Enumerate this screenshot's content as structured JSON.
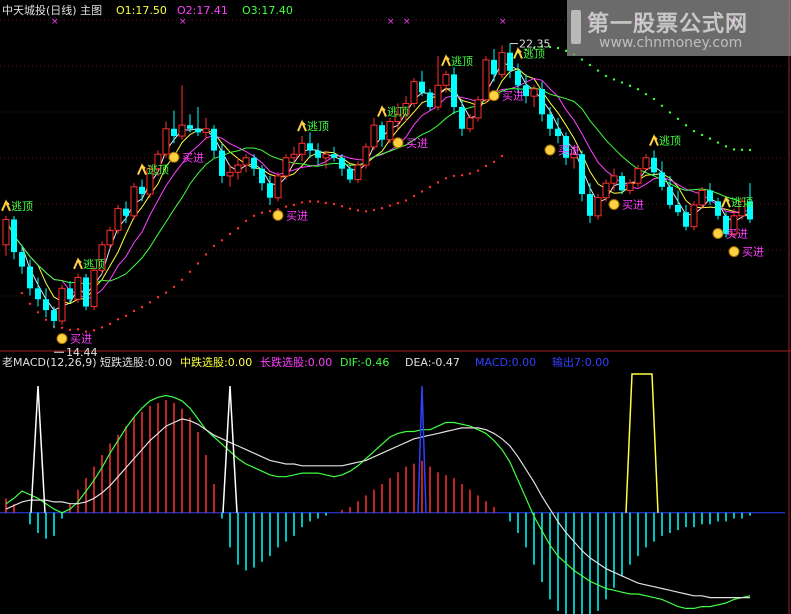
{
  "header": {
    "title": "中天城投(日线) 主图",
    "o1": "O1:17.50",
    "o2": "O2:17.41",
    "o3": "O3:17.40"
  },
  "indicator_header": {
    "name": "老MACD(12,26,9)",
    "short": "短跌选股:0.00",
    "mid": "中跌选股:0.00",
    "long": "长跌选股:0.00",
    "dif": "DIF:-0.46",
    "dea": "DEA:-0.47",
    "macd": "MACD:0.00",
    "output": "输出7:0.00"
  },
  "watermark": {
    "title": "第一股票公式网",
    "url": "www.chnmoney.com"
  },
  "colors": {
    "up": "#ff3030",
    "down": "#00ffff",
    "buy_text": "#ff40ff",
    "sell_text": "#40ff40",
    "dif": "#40ff40",
    "dea": "#e0e0e0",
    "ma_white": "#e8e8e8",
    "ma_yellow": "#ffff40",
    "ma_magenta": "#ff40ff",
    "ma_green": "#40ff40",
    "signal_blue": "#3040ff",
    "signal_yellow": "#ffff40"
  },
  "chart_data": {
    "type": "candlestick+macd",
    "annotations": {
      "high_label": "22.35",
      "low_label": "14.44",
      "buy_label": "买进",
      "sell_label": "逃顶"
    },
    "candles": [
      [
        16.8,
        17.6,
        16.5,
        17.5
      ],
      [
        17.5,
        17.6,
        16.4,
        16.6
      ],
      [
        16.6,
        16.8,
        16.0,
        16.2
      ],
      [
        16.2,
        16.4,
        15.4,
        15.6
      ],
      [
        15.6,
        15.9,
        15.1,
        15.3
      ],
      [
        15.3,
        15.6,
        14.8,
        15.0
      ],
      [
        15.0,
        15.1,
        14.5,
        14.7
      ],
      [
        14.7,
        15.7,
        14.6,
        15.6
      ],
      [
        15.6,
        15.8,
        15.2,
        15.3
      ],
      [
        15.3,
        16.0,
        15.2,
        15.9
      ],
      [
        15.9,
        16.0,
        15.0,
        15.1
      ],
      [
        15.1,
        16.2,
        15.0,
        16.1
      ],
      [
        16.1,
        16.9,
        16.0,
        16.8
      ],
      [
        16.8,
        17.3,
        16.7,
        17.2
      ],
      [
        17.2,
        17.9,
        17.1,
        17.8
      ],
      [
        17.8,
        18.0,
        17.4,
        17.6
      ],
      [
        17.6,
        18.5,
        17.5,
        18.4
      ],
      [
        18.4,
        18.6,
        18.0,
        18.2
      ],
      [
        18.2,
        19.0,
        18.1,
        18.9
      ],
      [
        18.9,
        19.4,
        18.7,
        19.3
      ],
      [
        19.3,
        20.2,
        19.2,
        20.0
      ],
      [
        20.0,
        20.5,
        19.6,
        19.8
      ],
      [
        19.8,
        21.2,
        19.7,
        20.1
      ],
      [
        20.1,
        20.4,
        19.9,
        20.0
      ],
      [
        20.0,
        20.6,
        19.8,
        19.9
      ],
      [
        19.9,
        20.3,
        19.7,
        20.0
      ],
      [
        20.0,
        20.1,
        19.2,
        19.4
      ],
      [
        19.4,
        19.6,
        18.5,
        18.7
      ],
      [
        18.7,
        19.0,
        18.4,
        18.8
      ],
      [
        18.8,
        19.2,
        18.6,
        19.0
      ],
      [
        19.0,
        19.3,
        18.8,
        19.2
      ],
      [
        19.2,
        19.3,
        18.7,
        18.9
      ],
      [
        18.9,
        19.0,
        18.3,
        18.5
      ],
      [
        18.5,
        18.7,
        17.9,
        18.1
      ],
      [
        18.1,
        18.8,
        18.0,
        18.7
      ],
      [
        18.7,
        19.3,
        18.6,
        19.2
      ],
      [
        19.2,
        19.5,
        19.0,
        19.3
      ],
      [
        19.3,
        19.8,
        19.1,
        19.6
      ],
      [
        19.6,
        19.9,
        19.2,
        19.4
      ],
      [
        19.4,
        19.6,
        19.0,
        19.2
      ],
      [
        19.2,
        19.4,
        18.9,
        19.3
      ],
      [
        19.3,
        19.5,
        19.1,
        19.2
      ],
      [
        19.2,
        19.3,
        18.7,
        18.9
      ],
      [
        18.9,
        19.0,
        18.5,
        18.6
      ],
      [
        18.6,
        19.1,
        18.5,
        19.0
      ],
      [
        19.0,
        19.6,
        18.9,
        19.5
      ],
      [
        19.5,
        20.3,
        19.4,
        20.1
      ],
      [
        20.1,
        20.2,
        19.5,
        19.7
      ],
      [
        19.7,
        20.3,
        19.6,
        20.2
      ],
      [
        20.2,
        20.7,
        20.0,
        20.4
      ],
      [
        20.4,
        20.9,
        20.2,
        20.7
      ],
      [
        20.7,
        21.4,
        20.6,
        21.3
      ],
      [
        21.3,
        21.6,
        20.9,
        21.0
      ],
      [
        21.0,
        21.1,
        20.5,
        20.6
      ],
      [
        20.6,
        22.0,
        20.5,
        21.2
      ],
      [
        21.2,
        21.6,
        21.0,
        21.5
      ],
      [
        21.5,
        21.7,
        20.4,
        20.6
      ],
      [
        20.6,
        20.8,
        19.8,
        20.0
      ],
      [
        20.0,
        20.4,
        19.9,
        20.3
      ],
      [
        20.3,
        20.9,
        20.2,
        20.8
      ],
      [
        20.8,
        22.0,
        20.7,
        21.9
      ],
      [
        21.9,
        22.2,
        21.3,
        21.5
      ],
      [
        21.5,
        22.3,
        21.4,
        22.1
      ],
      [
        22.1,
        22.35,
        21.4,
        21.6
      ],
      [
        21.6,
        21.8,
        21.0,
        21.2
      ],
      [
        21.2,
        21.5,
        20.7,
        20.9
      ],
      [
        20.9,
        21.2,
        20.6,
        21.1
      ],
      [
        21.1,
        21.3,
        20.2,
        20.4
      ],
      [
        20.4,
        20.6,
        19.8,
        20.0
      ],
      [
        20.0,
        20.3,
        19.6,
        19.8
      ],
      [
        19.8,
        19.9,
        19.0,
        19.2
      ],
      [
        19.2,
        19.5,
        18.9,
        19.3
      ],
      [
        19.3,
        19.4,
        18.0,
        18.2
      ],
      [
        18.2,
        18.5,
        17.4,
        17.6
      ],
      [
        17.6,
        18.2,
        17.5,
        18.1
      ],
      [
        18.1,
        18.6,
        18.0,
        18.5
      ],
      [
        18.5,
        18.9,
        18.3,
        18.7
      ],
      [
        18.7,
        18.8,
        18.2,
        18.3
      ],
      [
        18.3,
        18.6,
        18.2,
        18.5
      ],
      [
        18.5,
        19.0,
        18.4,
        18.9
      ],
      [
        18.9,
        19.3,
        18.8,
        19.2
      ],
      [
        19.2,
        19.4,
        18.7,
        18.8
      ],
      [
        18.8,
        19.1,
        18.3,
        18.4
      ],
      [
        18.4,
        18.7,
        17.8,
        17.9
      ],
      [
        17.9,
        18.3,
        17.6,
        17.7
      ],
      [
        17.7,
        17.9,
        17.2,
        17.3
      ],
      [
        17.3,
        18.0,
        17.2,
        17.9
      ],
      [
        17.9,
        18.4,
        17.8,
        18.3
      ],
      [
        18.3,
        18.5,
        17.9,
        18.0
      ],
      [
        18.0,
        18.1,
        17.5,
        17.6
      ],
      [
        17.6,
        17.7,
        17.0,
        17.1
      ],
      [
        17.1,
        17.8,
        17.0,
        17.6
      ],
      [
        17.6,
        18.1,
        17.5,
        18.0
      ],
      [
        18.0,
        18.5,
        17.4,
        17.5
      ]
    ],
    "buy_points": [
      7,
      21,
      34,
      49,
      61,
      68,
      76,
      89,
      91
    ],
    "sell_points": [
      0,
      9,
      17,
      37,
      47,
      55,
      64,
      81,
      90
    ],
    "high_point_index": 63,
    "low_point_index": 6,
    "macd_hist": [
      0.05,
      0.03,
      0.0,
      -0.04,
      -0.07,
      -0.09,
      -0.08,
      -0.02,
      0.03,
      0.08,
      0.12,
      0.16,
      0.2,
      0.24,
      0.27,
      0.3,
      0.33,
      0.35,
      0.37,
      0.38,
      0.39,
      0.38,
      0.36,
      0.33,
      0.28,
      0.2,
      0.1,
      -0.02,
      -0.12,
      -0.18,
      -0.2,
      -0.19,
      -0.17,
      -0.15,
      -0.12,
      -0.1,
      -0.08,
      -0.05,
      -0.03,
      -0.02,
      -0.01,
      0.0,
      0.01,
      0.02,
      0.04,
      0.06,
      0.08,
      0.1,
      0.12,
      0.14,
      0.16,
      0.17,
      0.18,
      0.16,
      0.14,
      0.13,
      0.12,
      0.1,
      0.08,
      0.06,
      0.04,
      0.02,
      0.0,
      -0.03,
      -0.07,
      -0.12,
      -0.18,
      -0.24,
      -0.3,
      -0.34,
      -0.36,
      -0.38,
      -0.4,
      -0.38,
      -0.34,
      -0.3,
      -0.26,
      -0.22,
      -0.18,
      -0.15,
      -0.12,
      -0.1,
      -0.08,
      -0.07,
      -0.06,
      -0.05,
      -0.05,
      -0.04,
      -0.04,
      -0.03,
      -0.03,
      -0.02,
      -0.02,
      -0.01
    ],
    "dif": [
      0.05,
      0.08,
      0.12,
      0.1,
      0.08,
      0.05,
      0.02,
      0.0,
      0.02,
      0.06,
      0.12,
      0.18,
      0.25,
      0.33,
      0.4,
      0.47,
      0.53,
      0.58,
      0.62,
      0.64,
      0.65,
      0.64,
      0.62,
      0.58,
      0.52,
      0.46,
      0.42,
      0.38,
      0.34,
      0.3,
      0.27,
      0.25,
      0.23,
      0.21,
      0.2,
      0.2,
      0.21,
      0.22,
      0.22,
      0.22,
      0.21,
      0.2,
      0.21,
      0.23,
      0.26,
      0.3,
      0.34,
      0.38,
      0.42,
      0.44,
      0.45,
      0.45,
      0.46,
      0.46,
      0.48,
      0.5,
      0.5,
      0.49,
      0.48,
      0.46,
      0.44,
      0.4,
      0.35,
      0.28,
      0.18,
      0.08,
      -0.02,
      -0.1,
      -0.18,
      -0.24,
      -0.28,
      -0.32,
      -0.35,
      -0.38,
      -0.4,
      -0.42,
      -0.43,
      -0.44,
      -0.45,
      -0.45,
      -0.46,
      -0.47,
      -0.48,
      -0.5,
      -0.52,
      -0.53,
      -0.53,
      -0.52,
      -0.52,
      -0.51,
      -0.5,
      -0.48,
      -0.47,
      -0.46
    ],
    "dea": [
      0.02,
      0.04,
      0.06,
      0.07,
      0.07,
      0.07,
      0.06,
      0.06,
      0.05,
      0.05,
      0.06,
      0.08,
      0.11,
      0.15,
      0.2,
      0.25,
      0.3,
      0.35,
      0.4,
      0.44,
      0.48,
      0.5,
      0.52,
      0.51,
      0.49,
      0.46,
      0.43,
      0.41,
      0.39,
      0.37,
      0.35,
      0.33,
      0.31,
      0.29,
      0.28,
      0.27,
      0.27,
      0.26,
      0.26,
      0.26,
      0.26,
      0.26,
      0.26,
      0.27,
      0.28,
      0.29,
      0.31,
      0.33,
      0.35,
      0.37,
      0.39,
      0.41,
      0.42,
      0.43,
      0.44,
      0.45,
      0.46,
      0.47,
      0.47,
      0.47,
      0.46,
      0.44,
      0.41,
      0.37,
      0.31,
      0.24,
      0.17,
      0.09,
      0.02,
      -0.05,
      -0.11,
      -0.16,
      -0.21,
      -0.25,
      -0.28,
      -0.31,
      -0.33,
      -0.35,
      -0.37,
      -0.39,
      -0.4,
      -0.41,
      -0.42,
      -0.43,
      -0.44,
      -0.45,
      -0.46,
      -0.46,
      -0.47,
      -0.47,
      -0.47,
      -0.47,
      -0.47,
      -0.47
    ],
    "signal_white_spikes": [
      4,
      28
    ],
    "signal_blue_spike": 52,
    "signal_yellow_plateau": [
      78,
      81
    ],
    "price_range": [
      13.9,
      23.0
    ],
    "macd_range": [
      -0.55,
      0.78
    ]
  }
}
